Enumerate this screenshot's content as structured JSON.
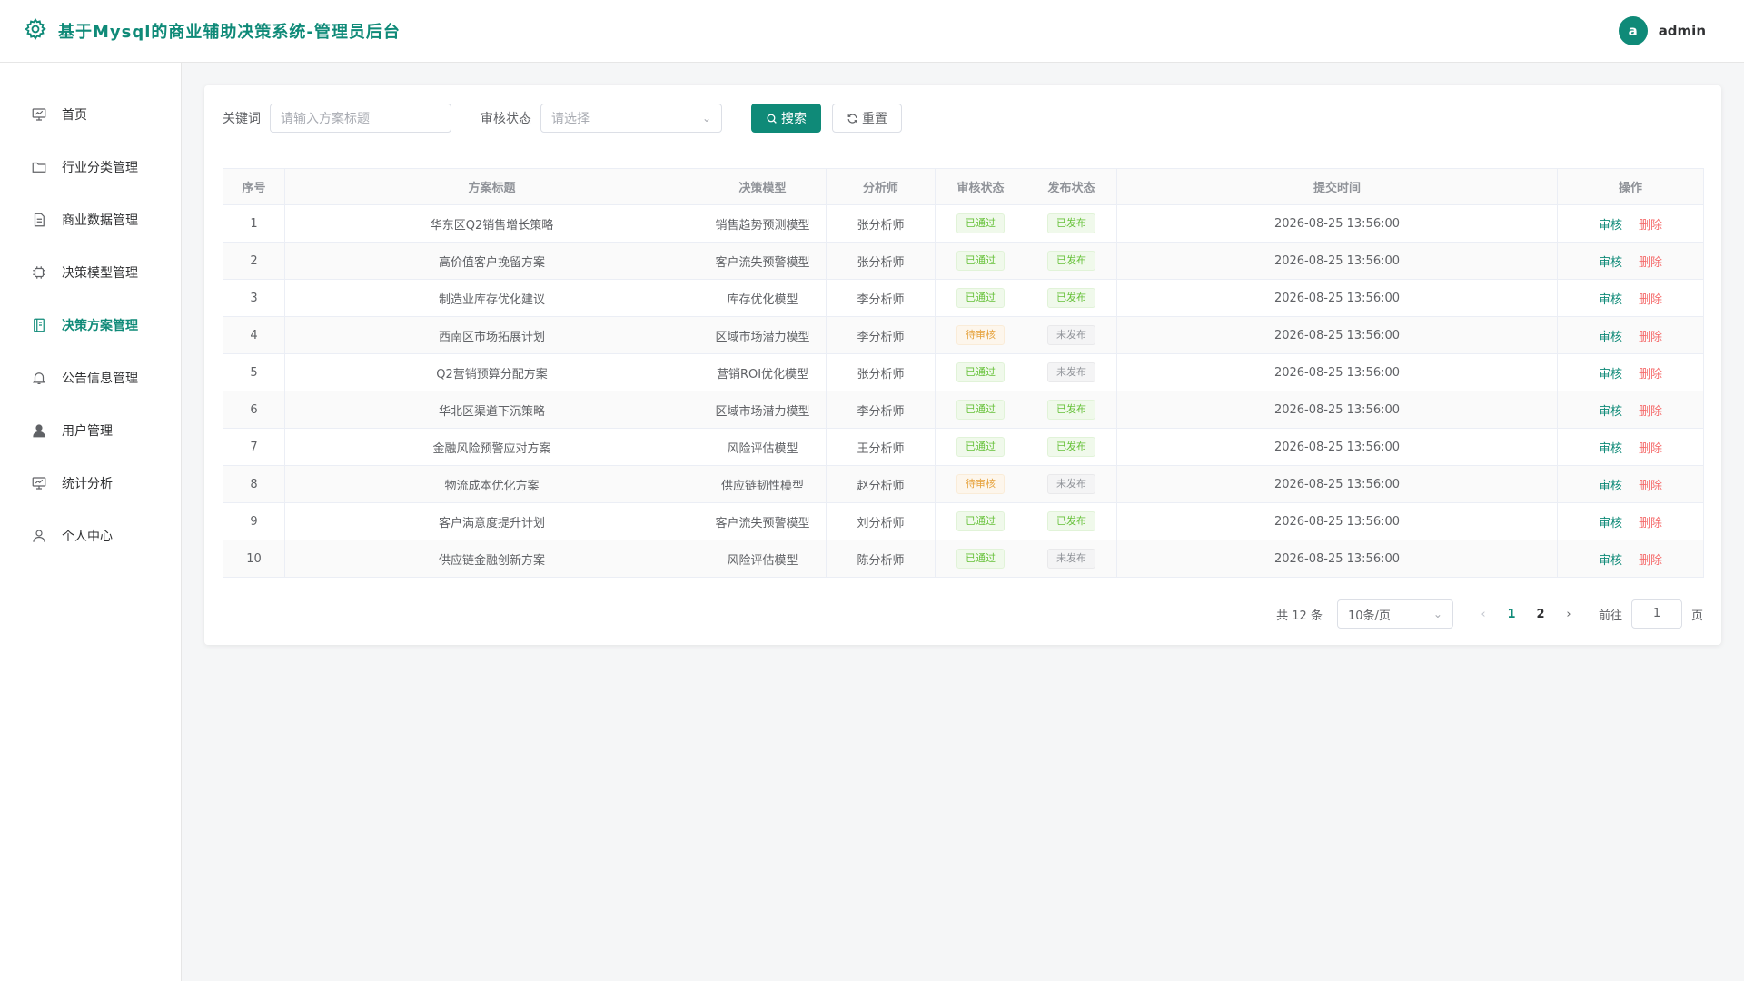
{
  "header": {
    "title": "基于Mysql的商业辅助决策系统-管理员后台",
    "avatar_letter": "a",
    "username": "admin"
  },
  "sidebar": {
    "items": [
      {
        "label": "首页",
        "icon": "presentation-icon"
      },
      {
        "label": "行业分类管理",
        "icon": "folder-icon"
      },
      {
        "label": "商业数据管理",
        "icon": "document-icon"
      },
      {
        "label": "决策模型管理",
        "icon": "cpu-icon"
      },
      {
        "label": "决策方案管理",
        "icon": "notebook-icon",
        "active": true
      },
      {
        "label": "公告信息管理",
        "icon": "bell-icon"
      },
      {
        "label": "用户管理",
        "icon": "user-filled-icon"
      },
      {
        "label": "统计分析",
        "icon": "presentation-icon"
      },
      {
        "label": "个人中心",
        "icon": "user-icon"
      }
    ]
  },
  "filters": {
    "keyword_label": "关键词",
    "keyword_placeholder": "请输入方案标题",
    "status_label": "审核状态",
    "status_placeholder": "请选择",
    "search_label": "搜索",
    "reset_label": "重置"
  },
  "table": {
    "columns": [
      "序号",
      "方案标题",
      "决策模型",
      "分析师",
      "审核状态",
      "发布状态",
      "提交时间",
      "操作"
    ],
    "action_audit": "审核",
    "action_delete": "删除",
    "rows": [
      {
        "no": "1",
        "title": "华东区Q2销售增长策略",
        "model": "销售趋势预测模型",
        "analyst": "张分析师",
        "audit": "已通过",
        "publish": "已发布",
        "time": "2026-08-25 13:56:00"
      },
      {
        "no": "2",
        "title": "高价值客户挽留方案",
        "model": "客户流失预警模型",
        "analyst": "张分析师",
        "audit": "已通过",
        "publish": "已发布",
        "time": "2026-08-25 13:56:00"
      },
      {
        "no": "3",
        "title": "制造业库存优化建议",
        "model": "库存优化模型",
        "analyst": "李分析师",
        "audit": "已通过",
        "publish": "已发布",
        "time": "2026-08-25 13:56:00"
      },
      {
        "no": "4",
        "title": "西南区市场拓展计划",
        "model": "区域市场潜力模型",
        "analyst": "李分析师",
        "audit": "待审核",
        "publish": "未发布",
        "time": "2026-08-25 13:56:00"
      },
      {
        "no": "5",
        "title": "Q2营销预算分配方案",
        "model": "营销ROI优化模型",
        "analyst": "张分析师",
        "audit": "已通过",
        "publish": "未发布",
        "time": "2026-08-25 13:56:00"
      },
      {
        "no": "6",
        "title": "华北区渠道下沉策略",
        "model": "区域市场潜力模型",
        "analyst": "李分析师",
        "audit": "已通过",
        "publish": "已发布",
        "time": "2026-08-25 13:56:00"
      },
      {
        "no": "7",
        "title": "金融风险预警应对方案",
        "model": "风险评估模型",
        "analyst": "王分析师",
        "audit": "已通过",
        "publish": "已发布",
        "time": "2026-08-25 13:56:00"
      },
      {
        "no": "8",
        "title": "物流成本优化方案",
        "model": "供应链韧性模型",
        "analyst": "赵分析师",
        "audit": "待审核",
        "publish": "未发布",
        "time": "2026-08-25 13:56:00"
      },
      {
        "no": "9",
        "title": "客户满意度提升计划",
        "model": "客户流失预警模型",
        "analyst": "刘分析师",
        "audit": "已通过",
        "publish": "已发布",
        "time": "2026-08-25 13:56:00"
      },
      {
        "no": "10",
        "title": "供应链金融创新方案",
        "model": "风险评估模型",
        "analyst": "陈分析师",
        "audit": "已通过",
        "publish": "未发布",
        "time": "2026-08-25 13:56:00"
      }
    ]
  },
  "pagination": {
    "total_text": "共 12 条",
    "page_size": "10条/页",
    "pages": [
      "1",
      "2"
    ],
    "current_page": "1",
    "goto_label": "前往",
    "goto_value": "1",
    "page_unit": "页"
  },
  "colors": {
    "accent": "#0f8a78",
    "success": "#67c23a",
    "warning": "#e6a23c",
    "info": "#909399",
    "danger": "#f56c6c"
  }
}
